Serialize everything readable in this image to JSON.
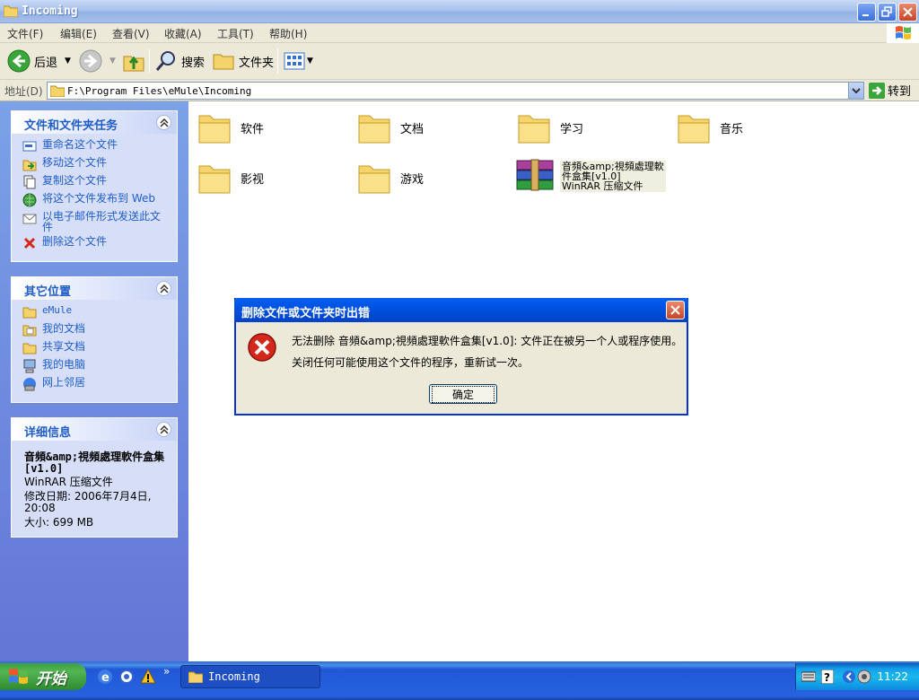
{
  "window": {
    "title": "Incoming"
  },
  "menu": [
    "文件(F)",
    "编辑(E)",
    "查看(V)",
    "收藏(A)",
    "工具(T)",
    "帮助(H)"
  ],
  "toolbar": {
    "back": "后退",
    "search": "搜索",
    "folders": "文件夹"
  },
  "address": {
    "label": "地址(D)",
    "path": "F:\\Program Files\\eMule\\Incoming",
    "go": "转到"
  },
  "tasks_panel": {
    "title": "文件和文件夹任务",
    "items": [
      {
        "label": "重命名这个文件",
        "icon": "rename-icon"
      },
      {
        "label": "移动这个文件",
        "icon": "move-icon"
      },
      {
        "label": "复制这个文件",
        "icon": "copy-icon"
      },
      {
        "label": "将这个文件发布到 Web",
        "icon": "publish-web-icon"
      },
      {
        "label": "以电子邮件形式发送此文件",
        "icon": "email-icon"
      },
      {
        "label": "删除这个文件",
        "icon": "delete-icon"
      }
    ]
  },
  "places_panel": {
    "title": "其它位置",
    "items": [
      {
        "label": "eMule",
        "icon": "folder-icon"
      },
      {
        "label": "我的文档",
        "icon": "my-documents-icon"
      },
      {
        "label": "共享文档",
        "icon": "shared-documents-icon"
      },
      {
        "label": "我的电脑",
        "icon": "my-computer-icon"
      },
      {
        "label": "网上邻居",
        "icon": "network-icon"
      }
    ]
  },
  "details_panel": {
    "title": "详细信息",
    "name": "音頻&amp;視頻處理軟件盒集[v1.0]",
    "type": "WinRAR 压缩文件",
    "modified": "修改日期: 2006年7月4日, 20:08",
    "size": "大小: 699 MB"
  },
  "files": [
    {
      "name": "软件"
    },
    {
      "name": "文档"
    },
    {
      "name": "学习"
    },
    {
      "name": "音乐"
    },
    {
      "name": "影视"
    },
    {
      "name": "游戏"
    }
  ],
  "rar_file": {
    "line1": "音頻&amp;視頻處理軟",
    "line2": "件盒集[v1.0]",
    "line3": "WinRAR 压缩文件"
  },
  "dialog": {
    "title": "删除文件或文件夹时出错",
    "message1": "无法删除 音頻&amp;視頻處理軟件盒集[v1.0]: 文件正在被另一个人或程序使用。",
    "message2": "关闭任何可能使用这个文件的程序，重新试一次。",
    "ok": "确定"
  },
  "taskbar": {
    "start": "开始",
    "task": "Incoming",
    "clock": "11:22"
  },
  "colors": {
    "accent": "#215dc6",
    "dialog_border": "#0831d9",
    "error_red": "#d4281c"
  }
}
